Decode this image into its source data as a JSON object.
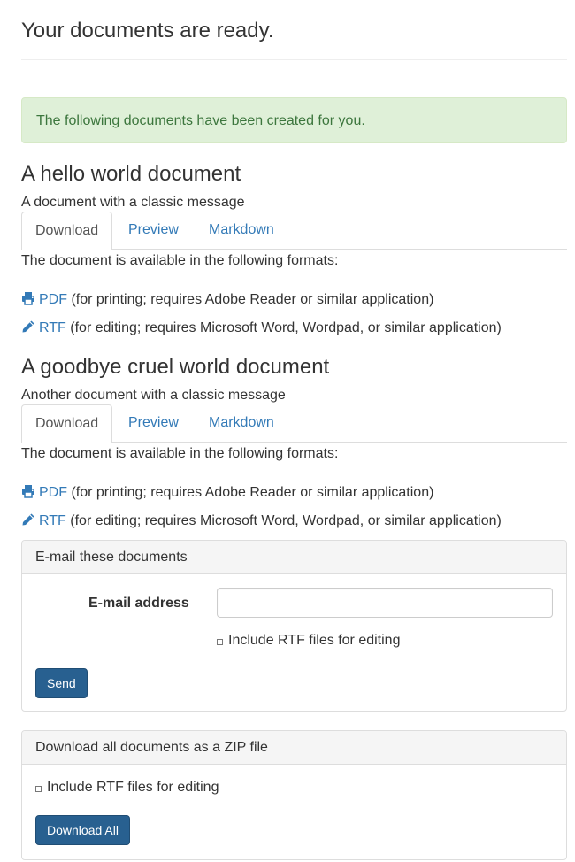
{
  "page": {
    "title": "Your documents are ready.",
    "alert": "The following documents have been created for you."
  },
  "documents": [
    {
      "title": "A hello world document",
      "description": "A document with a classic message",
      "tabs": [
        "Download",
        "Preview",
        "Markdown"
      ],
      "active_tab": "Download",
      "formats_intro": "The document is available in the following formats:",
      "formats": [
        {
          "icon": "printer-icon",
          "label": "PDF",
          "note": "(for printing; requires Adobe Reader or similar application)"
        },
        {
          "icon": "pencil-icon",
          "label": "RTF",
          "note": "(for editing; requires Microsoft Word, Wordpad, or similar application)"
        }
      ]
    },
    {
      "title": "A goodbye cruel world document",
      "description": "Another document with a classic message",
      "tabs": [
        "Download",
        "Preview",
        "Markdown"
      ],
      "active_tab": "Download",
      "formats_intro": "The document is available in the following formats:",
      "formats": [
        {
          "icon": "printer-icon",
          "label": "PDF",
          "note": "(for printing; requires Adobe Reader or similar application)"
        },
        {
          "icon": "pencil-icon",
          "label": "RTF",
          "note": "(for editing; requires Microsoft Word, Wordpad, or similar application)"
        }
      ]
    }
  ],
  "email_panel": {
    "heading": "E-mail these documents",
    "email_label": "E-mail address",
    "email_value": "",
    "email_placeholder": "",
    "include_rtf_label": "Include RTF files for editing",
    "include_rtf_checked": false,
    "send_label": "Send"
  },
  "zip_panel": {
    "heading": "Download all documents as a ZIP file",
    "include_rtf_label": "Include RTF files for editing",
    "include_rtf_checked": false,
    "download_label": "Download All"
  },
  "colors": {
    "link": "#337ab7",
    "alert_bg": "#dff0d8",
    "alert_text": "#3c763d",
    "primary_button": "#286090"
  }
}
